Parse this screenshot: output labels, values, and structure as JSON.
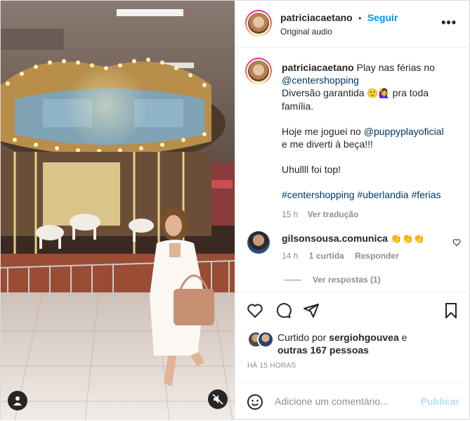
{
  "post": {
    "username": "patriciacaetano",
    "separator": "•",
    "follow_label": "Seguir",
    "audio_label": "Original audio",
    "more_label": "•••"
  },
  "caption": {
    "username": "patriciacaetano",
    "line1": "Play nas férias no",
    "mention1": "@centershopping",
    "line2_text": "Diversão garantida",
    "line2_emojis": "🙂🙋‍♀️",
    "line2_end": "pra toda",
    "line3": "família.",
    "line4_text": "Hoje me joguei no",
    "mention2": "@puppyplayoficial",
    "line5": "e me diverti à beça!!!",
    "line6": "Uhullll foi top!",
    "hashtags": "#centershopping #uberlandia #ferias",
    "time": "15 h",
    "translate": "Ver tradução"
  },
  "comment": {
    "username": "gilsonsousa.comunica",
    "emojis": "👏👏👏",
    "time": "14 h",
    "likes": "1 curtida",
    "reply": "Responder",
    "view_replies": "Ver respostas (1)"
  },
  "likes": {
    "prefix": "Curtido por",
    "user": "sergiohgouvea",
    "and": "e",
    "others": "outras 167 pessoas"
  },
  "timestamp": "HÁ 15 HORAS",
  "add_comment": {
    "placeholder": "Adicione um comentário...",
    "post_label": "Publicar"
  },
  "colors": {
    "link": "#0095f6",
    "mention": "#00376b",
    "muted": "#8e8e8e"
  }
}
